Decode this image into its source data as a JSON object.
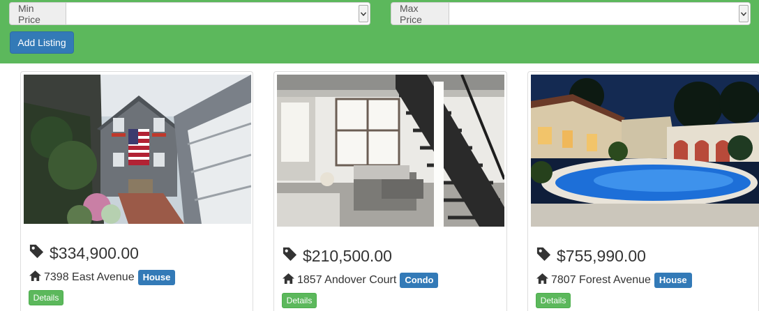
{
  "filters": {
    "min_price_label": "Min Price",
    "min_price_value": "",
    "max_price_label": "Max Price",
    "max_price_value": "",
    "add_listing_label": "Add Listing"
  },
  "colors": {
    "filter_bar": "#5cb85c",
    "primary": "#337ab7",
    "success": "#5cb85c"
  },
  "listings": [
    {
      "price": "$334,900.00",
      "address": "7398 East Avenue",
      "type": "House",
      "details_label": "Details",
      "photo": "photo of a grey-shingled house with an american flag on a narrow brick lane"
    },
    {
      "price": "$210,500.00",
      "address": "1857 Andover Court",
      "type": "Condo",
      "details_label": "Details",
      "photo": "photo of a modern loft living room with a black metal staircase"
    },
    {
      "price": "$755,990.00",
      "address": "7807 Forest Avenue",
      "type": "House",
      "details_label": "Details",
      "photo": "photo of a lit villa with a swimming pool at night"
    }
  ]
}
